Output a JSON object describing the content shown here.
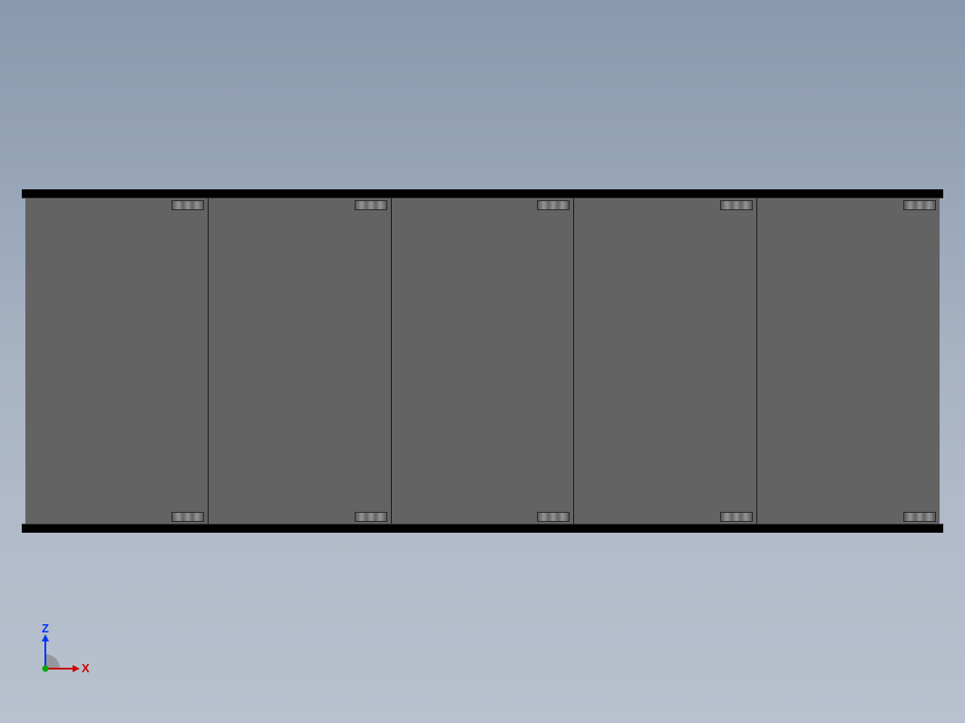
{
  "viewport": {
    "axes": {
      "z_label": "Z",
      "x_label": "X"
    }
  },
  "model": {
    "panel_count": 5
  }
}
